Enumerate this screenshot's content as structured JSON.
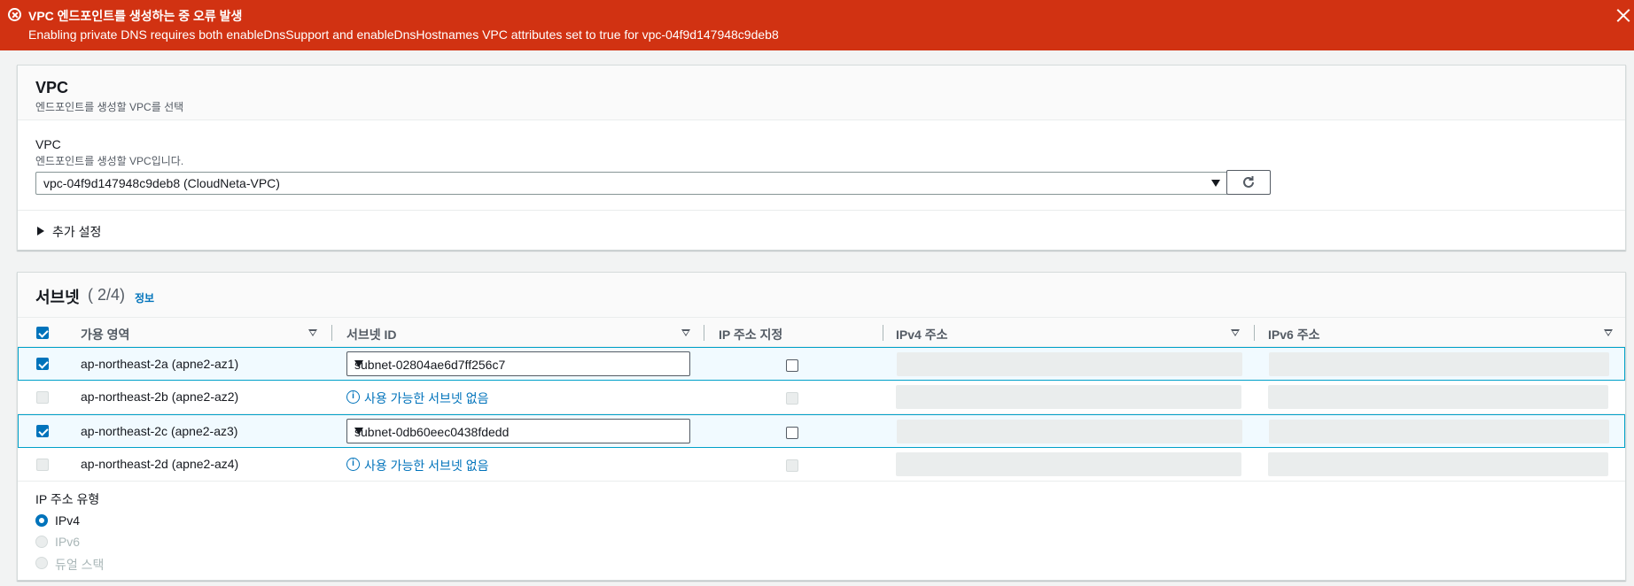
{
  "banner": {
    "title": "VPC 엔드포인트를 생성하는 중 오류 발생",
    "message": "Enabling private DNS requires both enableDnsSupport and enableDnsHostnames VPC attributes set to true for vpc-04f9d147948c9deb8",
    "color": "#d13212"
  },
  "vpc_section": {
    "title": "VPC",
    "description": "엔드포인트를 생성할 VPC를 선택",
    "field_label": "VPC",
    "field_description": "엔드포인트를 생성할 VPC입니다.",
    "selected_vpc": "vpc-04f9d147948c9deb8 (CloudNeta-VPC)",
    "extra_settings": "추가 설정"
  },
  "subnet_section": {
    "title": "서브넷",
    "count": "( 2/4)",
    "info": "정보",
    "columns": [
      "가용 영역",
      "서브넷 ID",
      "IP 주소 지정",
      "IPv4 주소",
      "IPv6 주소"
    ],
    "rows": [
      {
        "az": "ap-northeast-2a (apne2-az1)",
        "subnet": "subnet-02804ae6d7ff256c7",
        "selected": true
      },
      {
        "az": "ap-northeast-2b (apne2-az2)",
        "subnet": "사용 가능한 서브넷 없음",
        "selected": false
      },
      {
        "az": "ap-northeast-2c (apne2-az3)",
        "subnet": "subnet-0db60eec0438fdedd",
        "selected": true
      },
      {
        "az": "ap-northeast-2d (apne2-az4)",
        "subnet": "사용 가능한 서브넷 없음",
        "selected": false
      }
    ],
    "ip_type_label": "IP 주소 유형",
    "ip_types": [
      "IPv4",
      "IPv6",
      "듀얼 스택"
    ]
  },
  "colors": {
    "accent": "#0073bb",
    "selected_border": "#00a1c9"
  }
}
